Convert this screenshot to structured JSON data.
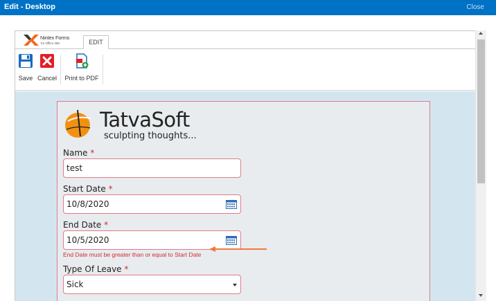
{
  "window": {
    "title": "Edit - Desktop",
    "close_label": "Close",
    "accent_color": "#0072c6"
  },
  "ribbon": {
    "brand": "Nintex Forms",
    "brand_sub": "for Office 365",
    "tab_label": "EDIT",
    "buttons": [
      {
        "label": "Save",
        "icon": "save-icon"
      },
      {
        "label": "Cancel",
        "icon": "cancel-icon"
      },
      {
        "label": "Print to PDF",
        "icon": "print-to-pdf-icon"
      }
    ]
  },
  "form": {
    "logo_name": "TatvaSoft",
    "logo_tagline": "sculpting thoughts...",
    "required_marker": "*",
    "error_color": "#d12b2b",
    "fields": [
      {
        "label": "Name",
        "value": "test"
      },
      {
        "label": "Start Date",
        "value": "10/8/2020",
        "icon": "calendar-icon"
      },
      {
        "label": "End Date",
        "value": "10/5/2020",
        "icon": "calendar-icon",
        "error": "End Date must be greater than or equal to Start Date"
      },
      {
        "label": "Type Of Leave",
        "value": "Sick",
        "icon": "chevron-down-icon"
      }
    ]
  }
}
